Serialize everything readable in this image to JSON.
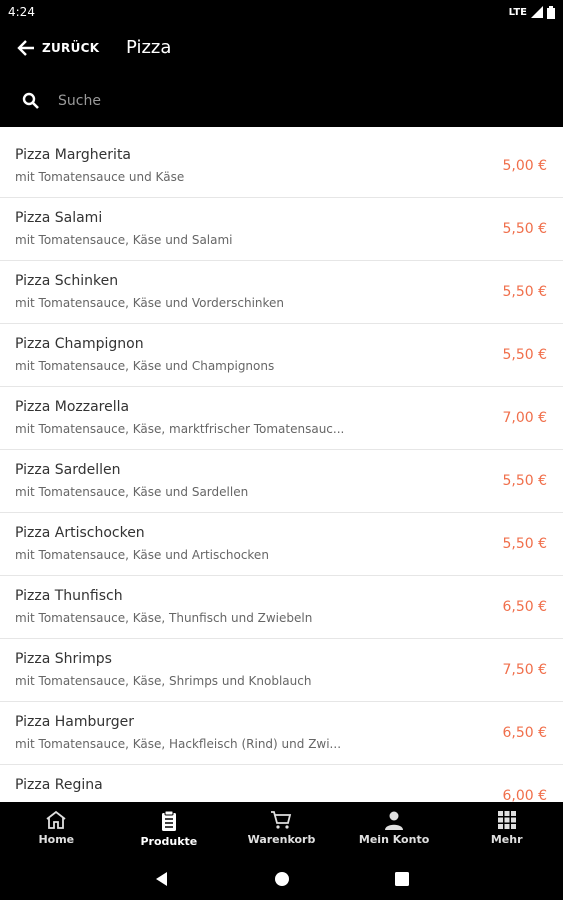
{
  "status_bar": {
    "time": "4:24",
    "network": "LTE"
  },
  "app_bar": {
    "back_label": "ZURÜCK",
    "title": "Pizza"
  },
  "search": {
    "placeholder": "Suche",
    "value": ""
  },
  "products": [
    {
      "name": "Pizza Margherita",
      "desc": "mit Tomatensauce und Käse",
      "price": "5,00 €"
    },
    {
      "name": "Pizza Salami",
      "desc": "mit Tomatensauce, Käse und Salami",
      "price": "5,50 €"
    },
    {
      "name": "Pizza Schinken",
      "desc": "mit Tomatensauce, Käse und Vorderschinken",
      "price": "5,50 €"
    },
    {
      "name": "Pizza Champignon",
      "desc": "mit Tomatensauce, Käse und Champignons",
      "price": "5,50 €"
    },
    {
      "name": "Pizza Mozzarella",
      "desc": "mit Tomatensauce, Käse, marktfrischer Tomatensauc...",
      "price": "7,00 €"
    },
    {
      "name": "Pizza Sardellen",
      "desc": "mit Tomatensauce, Käse und Sardellen",
      "price": "5,50 €"
    },
    {
      "name": "Pizza Artischocken",
      "desc": "mit Tomatensauce, Käse und Artischocken",
      "price": "5,50 €"
    },
    {
      "name": "Pizza Thunfisch",
      "desc": "mit Tomatensauce, Käse, Thunfisch und Zwiebeln",
      "price": "6,50 €"
    },
    {
      "name": "Pizza Shrimps",
      "desc": "mit Tomatensauce, Käse, Shrimps und Knoblauch",
      "price": "7,50 €"
    },
    {
      "name": "Pizza Hamburger",
      "desc": "mit Tomatensauce, Käse, Hackfleisch (Rind) und Zwi...",
      "price": "6,50 €"
    },
    {
      "name": "Pizza Regina",
      "desc": "",
      "price": "6,00 €"
    }
  ],
  "bottom_nav": [
    {
      "label": "Home",
      "icon": "home-icon"
    },
    {
      "label": "Produkte",
      "icon": "clipboard-icon"
    },
    {
      "label": "Warenkorb",
      "icon": "cart-icon"
    },
    {
      "label": "Mein Konto",
      "icon": "person-icon"
    },
    {
      "label": "Mehr",
      "icon": "grid-icon"
    }
  ],
  "colors": {
    "price": "#f06f4b",
    "bars": "#000000"
  }
}
